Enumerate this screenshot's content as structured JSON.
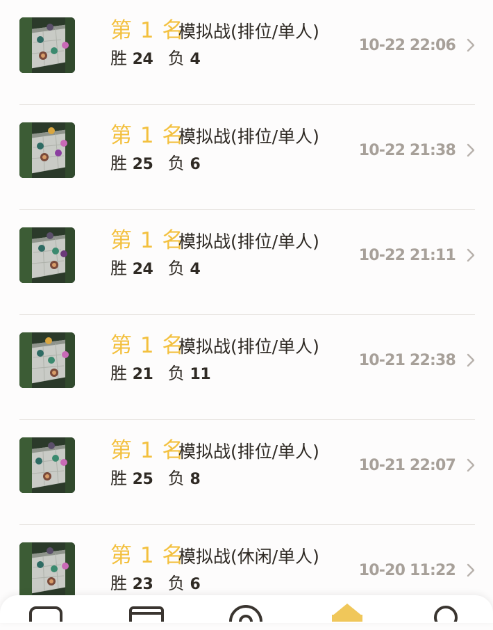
{
  "records": [
    {
      "rank": "第 1 名",
      "mode": "模拟战(排位/单人)",
      "win_label": "胜",
      "wins": "24",
      "loss_label": "负",
      "losses": "4",
      "time": "10-22 22:06",
      "thumb": "match-thumbnail"
    },
    {
      "rank": "第 1 名",
      "mode": "模拟战(排位/单人)",
      "win_label": "胜",
      "wins": "25",
      "loss_label": "负",
      "losses": "6",
      "time": "10-22 21:38",
      "thumb": "match-thumbnail"
    },
    {
      "rank": "第 1 名",
      "mode": "模拟战(排位/单人)",
      "win_label": "胜",
      "wins": "24",
      "loss_label": "负",
      "losses": "4",
      "time": "10-22 21:11",
      "thumb": "match-thumbnail"
    },
    {
      "rank": "第 1 名",
      "mode": "模拟战(排位/单人)",
      "win_label": "胜",
      "wins": "21",
      "loss_label": "负",
      "losses": "11",
      "time": "10-21 22:38",
      "thumb": "match-thumbnail"
    },
    {
      "rank": "第 1 名",
      "mode": "模拟战(排位/单人)",
      "win_label": "胜",
      "wins": "25",
      "loss_label": "负",
      "losses": "8",
      "time": "10-21 22:07",
      "thumb": "match-thumbnail"
    },
    {
      "rank": "第 1 名",
      "mode": "模拟战(休闲/单人)",
      "win_label": "胜",
      "wins": "23",
      "loss_label": "负",
      "losses": "6",
      "time": "10-20 11:22",
      "thumb": "match-thumbnail"
    }
  ],
  "tabbar": {
    "tabs": [
      {
        "icon": "chat-icon"
      },
      {
        "icon": "shop-icon"
      },
      {
        "icon": "discover-icon"
      },
      {
        "icon": "game-record-icon",
        "active": true
      },
      {
        "icon": "profile-icon"
      }
    ]
  },
  "colors": {
    "rank": "#f3c03e",
    "text": "#2f2a24",
    "time": "#a7a099",
    "divider": "#e6e2de",
    "active_tab": "#f0c75a"
  }
}
